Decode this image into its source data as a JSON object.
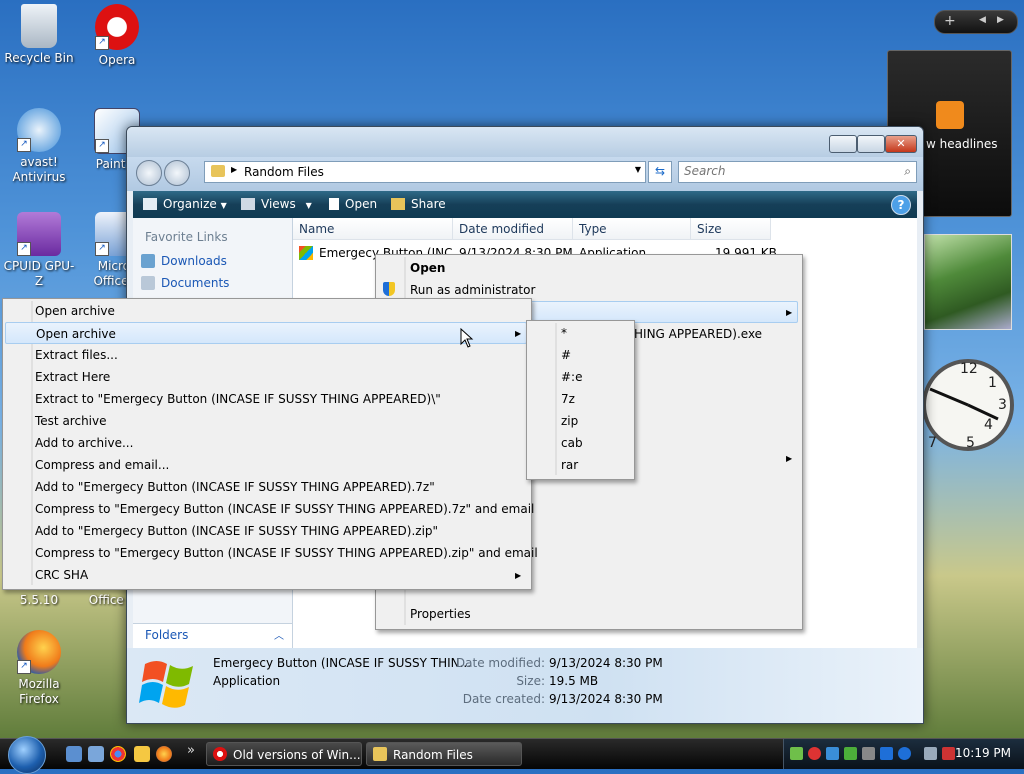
{
  "desktop": {
    "icons": [
      {
        "label": "Recycle Bin"
      },
      {
        "label": "Opera"
      },
      {
        "label": "avast! Antivirus"
      },
      {
        "label": "Paint.N"
      },
      {
        "label": "CPUID GPU-Z"
      },
      {
        "label": "Micros Office V"
      },
      {
        "label": "5.5.10"
      },
      {
        "label": "Office E"
      },
      {
        "label": "Mozilla Firefox"
      }
    ]
  },
  "sidebar": {
    "feed_text": "w headlines",
    "bar_add": "+"
  },
  "explorer": {
    "breadcrumb": "Random Files",
    "search_placeholder": "Search",
    "toolbar": {
      "organize": "Organize",
      "views": "Views",
      "open": "Open",
      "share": "Share",
      "help": "?"
    },
    "favorites_title": "Favorite Links",
    "favorites": [
      "Downloads",
      "Documents"
    ],
    "folders_label": "Folders",
    "columns": [
      "Name",
      "Date modified",
      "Type",
      "Size"
    ],
    "file_row": {
      "name": "Emergecy Button (INC",
      "date": "9/13/2024 8:30 PM",
      "type": "Application",
      "size": "19,991 KB"
    },
    "partial_filename": "HING APPEARED).exe",
    "details": {
      "filename": "Emergecy Button (INCASE IF SUSSY THIN...",
      "kind": "Application",
      "date_modified_label": "Date modified:",
      "date_modified": "9/13/2024 8:30 PM",
      "size_label": "Size:",
      "size": "19.5 MB",
      "date_created_label": "Date created:",
      "date_created": "9/13/2024 8:30 PM"
    }
  },
  "context_menu": {
    "open": "Open",
    "run_as_admin": "Run as administrator",
    "properties": "Properties"
  },
  "sevenzip_menu": {
    "items": [
      "Open archive",
      "Open archive",
      "Extract files...",
      "Extract Here",
      "Extract to \"Emergecy Button (INCASE IF SUSSY THING APPEARED)\\\"",
      "Test archive",
      "Add to archive...",
      "Compress and email...",
      "Add to \"Emergecy Button (INCASE IF SUSSY THING APPEARED).7z\"",
      "Compress to \"Emergecy Button (INCASE IF SUSSY THING APPEARED).7z\" and email",
      "Add to \"Emergecy Button (INCASE IF SUSSY THING APPEARED).zip\"",
      "Compress to \"Emergecy Button (INCASE IF SUSSY THING APPEARED).zip\" and email",
      "CRC SHA"
    ]
  },
  "open_archive_submenu": {
    "items": [
      "*",
      "#",
      "#:e",
      "7z",
      "zip",
      "cab",
      "rar"
    ]
  },
  "taskbar": {
    "tasks": [
      "Old versions of Win...",
      "Random Files"
    ],
    "more": "»",
    "clock": "10:19 PM"
  },
  "colors": {
    "toolbar": "#1b4a66",
    "link": "#1a57b5",
    "menu_bg": "#f0f0f0",
    "highlight": "#d4e7fb"
  }
}
